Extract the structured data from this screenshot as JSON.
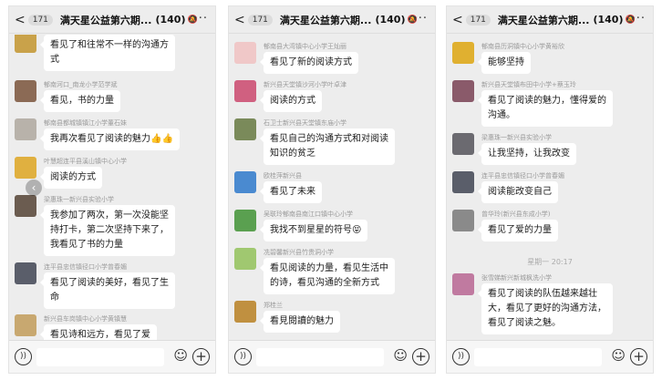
{
  "panels": [
    {
      "header": {
        "back": "<",
        "unread": "171",
        "title": "满天星公益第六期...",
        "count": "(140)",
        "more": "···"
      },
      "messages": [
        {
          "sender": "",
          "text": [
            "看见了和往常不一样的沟通方",
            "式"
          ],
          "avatar_color": "#c9a24a"
        },
        {
          "sender": "郁南河口_南龙小学范学斌",
          "text": [
            "看见，书的力量"
          ],
          "avatar_color": "#8b6a55"
        },
        {
          "sender": "郁南县都城镇镇江小学董石妹",
          "text": [
            "我再次看见了阅读的魅力👍👍"
          ],
          "avatar_color": "#b8b2aa"
        },
        {
          "sender": "叶慧超连平县溪山镇中心小学",
          "text": [
            "阅读的方式"
          ],
          "avatar_color": "#e0b040"
        },
        {
          "sender": "梁惠珠一新兴县实验小学",
          "text": [
            "我参加了两次，第一次没能坚",
            "持打卡，第二次坚持下来了，",
            "我看见了书的力量"
          ],
          "avatar_color": "#6b5c50"
        },
        {
          "sender": "连平县忠信镇径口小学曾春媚",
          "text": [
            "看见了阅读的美好，看见了生",
            "命"
          ],
          "avatar_color": "#5a5e6a"
        },
        {
          "sender": "新兴县车岗镇中心小学黄镇慧",
          "text": [
            "看见诗和远方，看见了爱"
          ],
          "avatar_color": "#c8a870"
        }
      ],
      "footer": {
        "voice": "))",
        "emoji": "☺",
        "plus": "+"
      }
    },
    {
      "header": {
        "back": "<",
        "unread": "171",
        "title": "满天星公益第六期...",
        "count": "(140)",
        "more": "···"
      },
      "messages": [
        {
          "sender": "郁南县大湾镇中心小学王灿丽",
          "text": [
            "看见了新的阅读方式"
          ],
          "avatar_color": "#f0c8c8"
        },
        {
          "sender": "新兴县天堂镇沙河小学叶卓津",
          "text": [
            "阅读的方式"
          ],
          "avatar_color": "#d06080"
        },
        {
          "sender": "石卫士新兴县天堂镇东庙小学",
          "text": [
            "看见自己的沟通方式和对阅读",
            "知识的贫乏"
          ],
          "avatar_color": "#7a8a5a"
        },
        {
          "sender": "欧桂萍新兴县",
          "text": [
            "看见了未来"
          ],
          "avatar_color": "#4a8ad0"
        },
        {
          "sender": "吴联玲郁南县南江口镇中心小学",
          "text": [
            "我找不到星星的符号😝"
          ],
          "avatar_color": "#5aa050"
        },
        {
          "sender": "冼碧馨新兴县竹贵洞小学",
          "text": [
            "看见阅读的力量，看见生活中",
            "的诗，看见沟通的全新方式"
          ],
          "avatar_color": "#a0c870"
        },
        {
          "sender": "郑桂兰",
          "text": [
            "看見閱讀的魅力"
          ],
          "avatar_color": "#c09040"
        }
      ],
      "footer": {
        "voice": "))",
        "emoji": "☺",
        "plus": "+"
      }
    },
    {
      "header": {
        "back": "<",
        "unread": "171",
        "title": "满天星公益第六期...",
        "count": "(140)",
        "more": "···"
      },
      "messages": [
        {
          "sender": "郁南县历洞镇中心小学黄裕欣",
          "text": [
            "能够坚持"
          ],
          "avatar_color": "#e0b030"
        },
        {
          "sender": "新兴县天堂镇布田中小学+蔡玉玲",
          "text": [
            "看见了阅读的魅力，懂得爱的",
            "沟通。"
          ],
          "avatar_color": "#8a5a6a"
        },
        {
          "sender": "梁惠珠一新兴县实验小学",
          "text": [
            "让我坚持，让我改变"
          ],
          "avatar_color": "#6b6a70"
        },
        {
          "sender": "连平县忠信镇径口小学曾春媚",
          "text": [
            "阅读能改变自己"
          ],
          "avatar_color": "#5a5e6a"
        },
        {
          "sender": "曾华玲(新兴县东成小学)",
          "text": [
            "看见了爱的力量"
          ],
          "avatar_color": "#8a8a8a"
        },
        {
          "sender": "张雪娣新兴新城枫洗小学",
          "text": [
            "看见了阅读的队伍越来越壮",
            "大，看见了更好的沟通方法，",
            "看见了阅读之魅。"
          ],
          "avatar_color": "#c07aa0"
        }
      ],
      "time_divider": "星期一 20:17",
      "footer": {
        "voice": "))",
        "emoji": "☺",
        "plus": "+"
      }
    }
  ],
  "side_arrow": "‹"
}
